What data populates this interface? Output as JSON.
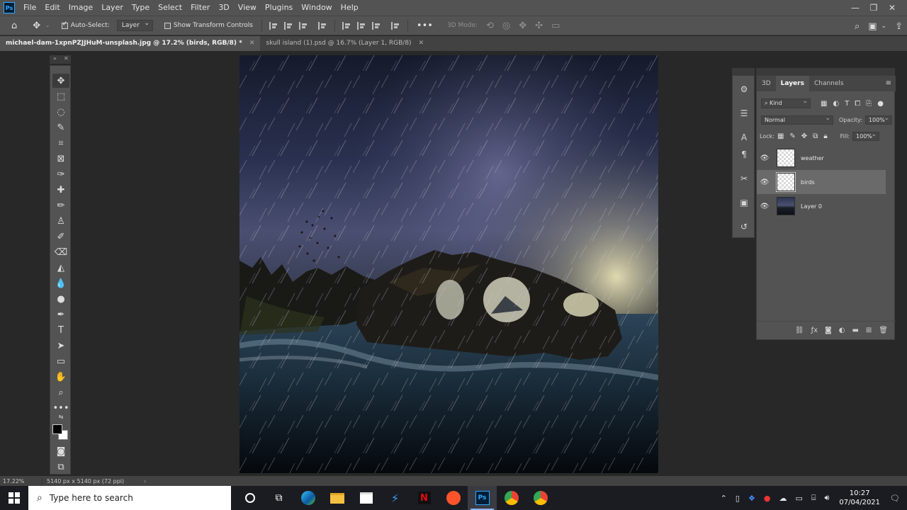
{
  "menubar": {
    "logo": "Ps",
    "items": [
      "File",
      "Edit",
      "Image",
      "Layer",
      "Type",
      "Select",
      "Filter",
      "3D",
      "View",
      "Plugins",
      "Window",
      "Help"
    ]
  },
  "options_bar": {
    "auto_select_label": "Auto-Select:",
    "auto_select_target": "Layer",
    "show_transform_label": "Show Transform Controls",
    "mode_3d_label": "3D Mode:",
    "more_label": "•••"
  },
  "tabs": [
    {
      "label": "michael-dam-1xpnPZJJHuM-unsplash.jpg @ 17.2% (birds, RGB/8) *",
      "active": true
    },
    {
      "label": "skull island (1).psd @ 16.7% (Layer 1, RGB/8)",
      "active": false
    }
  ],
  "layers_panel": {
    "tabs": [
      "3D",
      "Layers",
      "Channels"
    ],
    "active_tab": "Layers",
    "filter_kind": "Kind",
    "blend_mode": "Normal",
    "opacity_label": "Opacity:",
    "opacity_value": "100%",
    "lock_label": "Lock:",
    "fill_label": "Fill:",
    "fill_value": "100%",
    "layers": [
      {
        "name": "weather",
        "visible": true,
        "selected": false,
        "thumb": "transparent"
      },
      {
        "name": "birds",
        "visible": true,
        "selected": true,
        "thumb": "transparent"
      },
      {
        "name": "Layer 0",
        "visible": true,
        "selected": false,
        "thumb": "photo"
      }
    ]
  },
  "status_bar": {
    "zoom": "17.22%",
    "doc_info": "5140 px x 5140 px (72 ppi)",
    "arrow": "›"
  },
  "taskbar": {
    "search_placeholder": "Type here to search",
    "time": "10:27",
    "date": "07/04/2021"
  },
  "colors": {
    "foreground": "#000000",
    "background": "#ffffff",
    "ui_panel": "#535353",
    "workspace": "#282828"
  }
}
